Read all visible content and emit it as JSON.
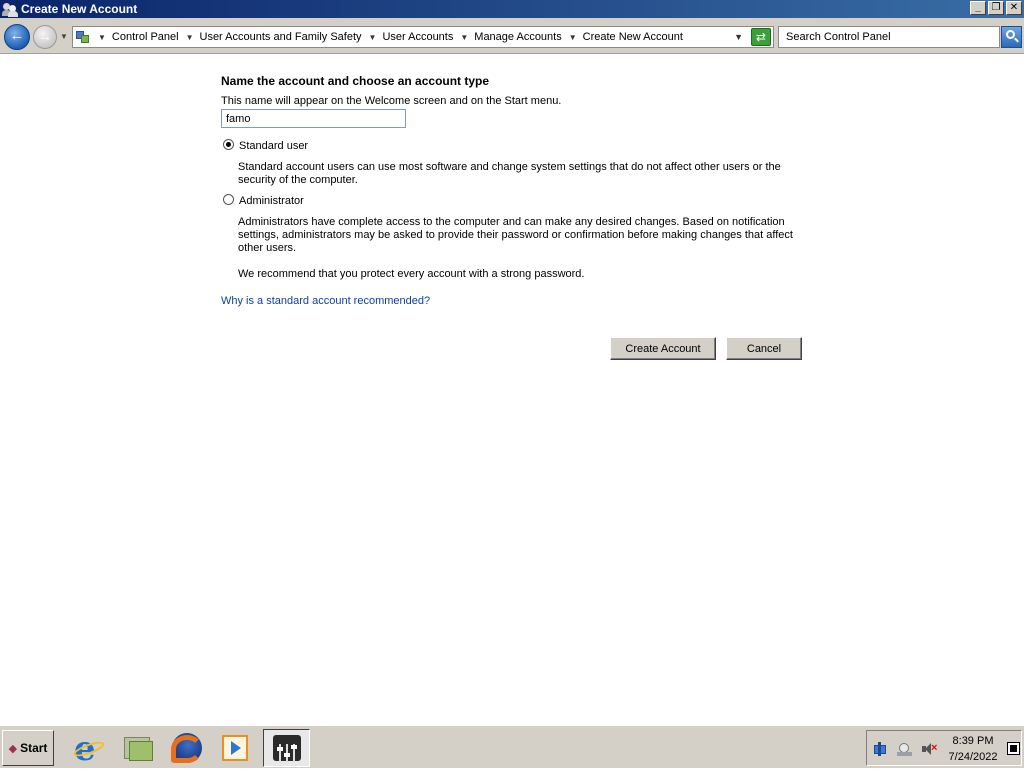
{
  "window": {
    "title": "Create New Account",
    "buttons": {
      "minimize": "_",
      "restore": "❐",
      "close": "✕"
    }
  },
  "nav": {
    "back_glyph": "←",
    "forward_glyph": "→",
    "breadcrumbs": [
      "Control Panel",
      "User Accounts and Family Safety",
      "User Accounts",
      "Manage Accounts",
      "Create New Account"
    ],
    "search_placeholder": "Search Control Panel"
  },
  "form": {
    "heading": "Name the account and choose an account type",
    "intro": "This name will appear on the Welcome screen and on the Start menu.",
    "name_value": "famo",
    "options": {
      "standard": {
        "label": "Standard user",
        "checked": true,
        "description": "Standard account users can use most software and change system settings that do not affect other users or the security of the computer."
      },
      "administrator": {
        "label": "Administrator",
        "checked": false,
        "description": "Administrators have complete access to the computer and can make any desired changes. Based on notification settings, administrators may be asked to provide their password or confirmation before making changes that affect other users."
      }
    },
    "recommendation": "We recommend that you protect every account with a strong password.",
    "why_link": "Why is a standard account recommended?",
    "create_button": "Create Account",
    "cancel_button": "Cancel"
  },
  "taskbar": {
    "start_label": "Start",
    "clock_time": "8:39 PM",
    "clock_date": "7/24/2022",
    "pinned": [
      "internet-explorer-icon",
      "file-manager-icon",
      "firefox-icon",
      "media-player-icon",
      "audio-mixer-icon"
    ]
  },
  "colors": {
    "titlebar_start": "#0a246a",
    "titlebar_end": "#3a6ea5",
    "link": "#0a3fa0",
    "chrome": "#d4d0c8"
  }
}
